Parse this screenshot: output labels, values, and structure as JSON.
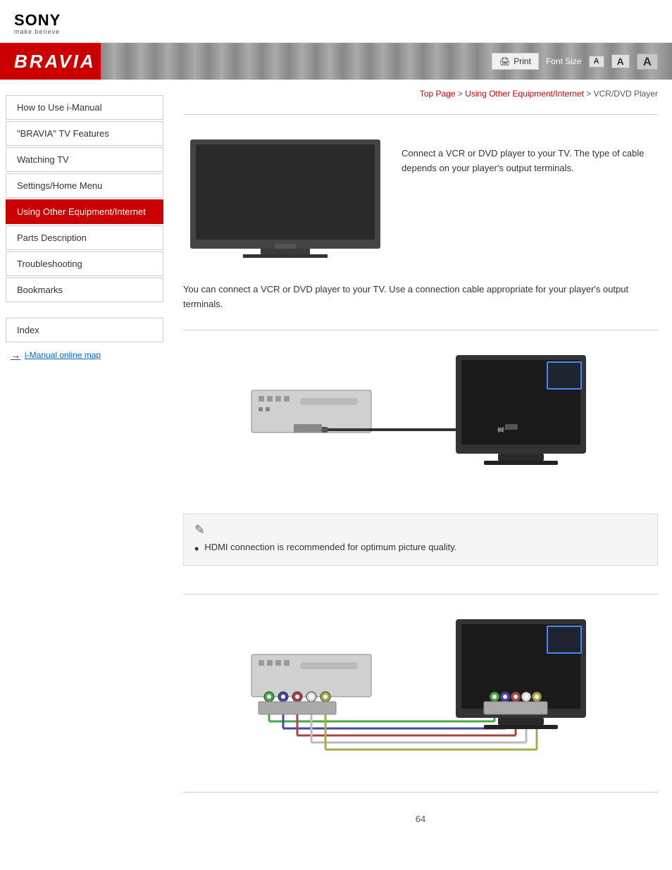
{
  "header": {
    "brand": "SONY",
    "tagline": "make.believe",
    "bravia": "BRAVIA",
    "print_label": "Print",
    "font_size_label": "Font Size",
    "font_small": "A",
    "font_medium": "A",
    "font_large": "A"
  },
  "breadcrumb": {
    "top_page": "Top Page",
    "separator1": " > ",
    "using_other": "Using Other Equipment/Internet",
    "separator2": " > ",
    "current": "VCR/DVD Player"
  },
  "sidebar": {
    "items": [
      {
        "label": "How to Use i-Manual",
        "active": false
      },
      {
        "label": "\"BRAVIA\" TV Features",
        "active": false
      },
      {
        "label": "Watching TV",
        "active": false
      },
      {
        "label": "Settings/Home Menu",
        "active": false
      },
      {
        "label": "Using Other Equipment/Internet",
        "active": true
      },
      {
        "label": "Parts Description",
        "active": false
      },
      {
        "label": "Troubleshooting",
        "active": false
      },
      {
        "label": "Bookmarks",
        "active": false
      }
    ],
    "index_label": "Index",
    "link_label": "i-Manual online map"
  },
  "content": {
    "intro_text": "Connect a VCR or DVD player to your TV. The type of cable depends on your player's output terminals.",
    "desc_text": "You can connect a VCR or DVD player to your TV. Use a connection cable appropriate for your player's output terminals.",
    "note_icon": "✎",
    "note_bullet": "HDMI connection is recommended for optimum picture quality.",
    "page_number": "64"
  }
}
